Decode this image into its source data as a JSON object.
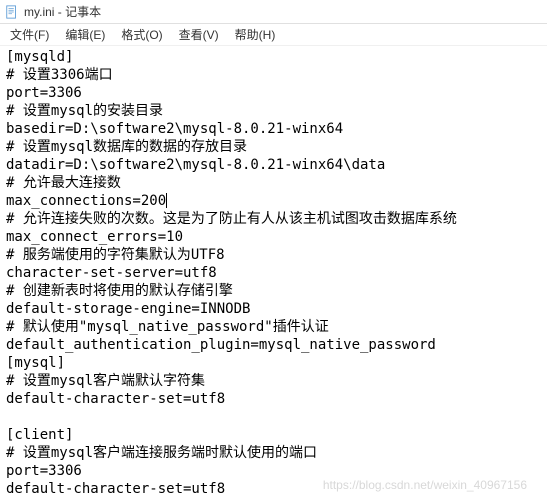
{
  "titlebar": {
    "filename": "my.ini",
    "separator": " - ",
    "appname": "记事本"
  },
  "menubar": {
    "file": "文件(F)",
    "edit": "编辑(E)",
    "format": "格式(O)",
    "view": "查看(V)",
    "help": "帮助(H)"
  },
  "content": {
    "lines": [
      "[mysqld]",
      "# 设置3306端口",
      "port=3306",
      "# 设置mysql的安装目录",
      "basedir=D:\\software2\\mysql-8.0.21-winx64",
      "# 设置mysql数据库的数据的存放目录",
      "datadir=D:\\software2\\mysql-8.0.21-winx64\\data",
      "# 允许最大连接数",
      "max_connections=200",
      "# 允许连接失败的次数。这是为了防止有人从该主机试图攻击数据库系统",
      "max_connect_errors=10",
      "# 服务端使用的字符集默认为UTF8",
      "character-set-server=utf8",
      "# 创建新表时将使用的默认存储引擎",
      "default-storage-engine=INNODB",
      "# 默认使用\"mysql_native_password\"插件认证",
      "default_authentication_plugin=mysql_native_password",
      "[mysql]",
      "# 设置mysql客户端默认字符集",
      "default-character-set=utf8",
      "",
      "[client]",
      "# 设置mysql客户端连接服务端时默认使用的端口",
      "port=3306",
      "default-character-set=utf8"
    ],
    "cursor_line": 8
  },
  "watermark": "https://blog.csdn.net/weixin_40967156"
}
